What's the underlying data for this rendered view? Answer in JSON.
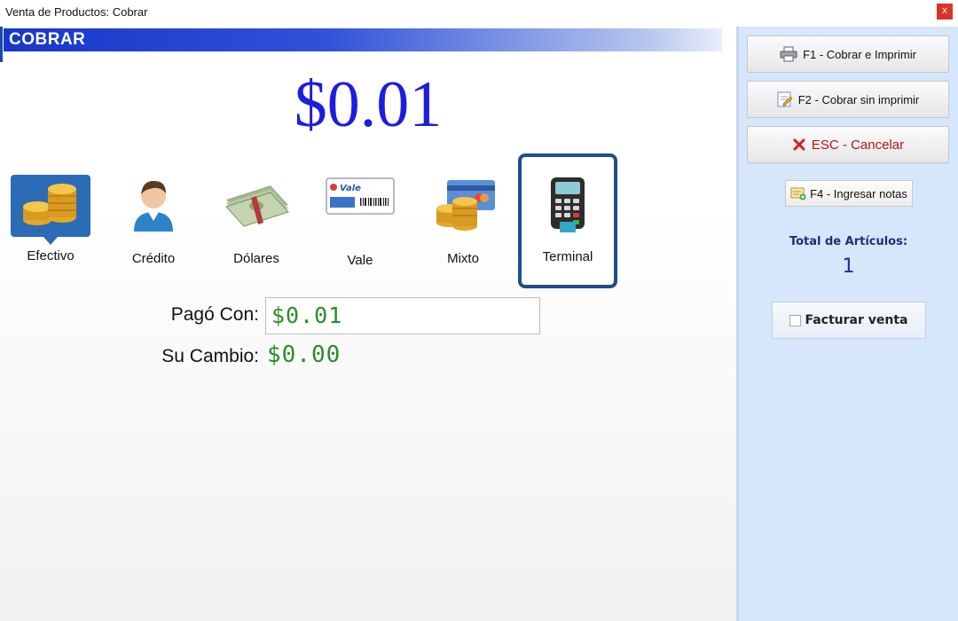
{
  "window": {
    "title": "Venta de Productos: Cobrar",
    "close_label": "x"
  },
  "main": {
    "section_title": "COBRAR",
    "amount": "$0.01",
    "payment_methods": [
      {
        "label": "Efectivo",
        "icon": "coins-icon"
      },
      {
        "label": "Crédito",
        "icon": "person-icon"
      },
      {
        "label": "Dólares",
        "icon": "dollar-bills-icon"
      },
      {
        "label": "Vale",
        "icon": "voucher-icon",
        "icon_text": "Vale"
      },
      {
        "label": "Mixto",
        "icon": "card-and-coins-icon"
      },
      {
        "label": "Terminal",
        "icon": "card-terminal-icon"
      }
    ],
    "selected_method": "Terminal",
    "pago_con_label": "Pagó Con:",
    "pago_con_value": "$0.01",
    "su_cambio_label": "Su Cambio:",
    "su_cambio_value": "$0.00"
  },
  "sidebar": {
    "f1_label": "F1 - Cobrar e Imprimir",
    "f2_label": "F2 - Cobrar sin imprimir",
    "esc_label": "ESC - Cancelar",
    "f4_label": "F4 - Ingresar notas",
    "total_label": "Total de Artículos:",
    "total_value": "1",
    "facturar_label": "Facturar venta"
  },
  "colors": {
    "accent": "#1737c9",
    "amount": "#1d1ce0",
    "money_green": "#2a8c2a",
    "selected_border": "#1d4f8a",
    "sidebar_bg": "#d6e6fb"
  }
}
